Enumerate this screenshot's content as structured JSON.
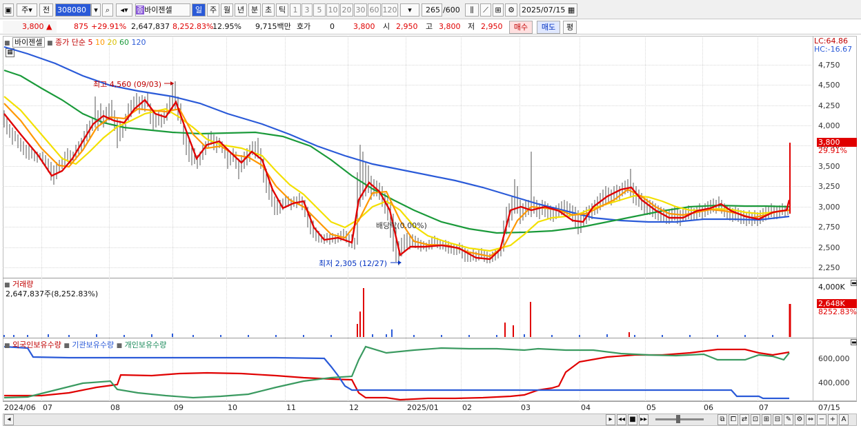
{
  "toolbar": {
    "type_label": "주",
    "prev_label": "전",
    "code": "308080",
    "stock_badge": "종",
    "stock_name": "바이젠셀",
    "periods": [
      "일",
      "주",
      "월",
      "년",
      "분",
      "초",
      "틱"
    ],
    "intervals": [
      "1",
      "3",
      "5",
      "10",
      "20",
      "30",
      "60",
      "120"
    ],
    "count": "265",
    "count_max": "/600",
    "date": "2025/07/15"
  },
  "quote": {
    "price": "3,800",
    "change": "875",
    "change_pct": "+29.91%",
    "volume": "2,647,837",
    "volume_pct": "8,252.83%",
    "turnover": "12.95%",
    "amount": "9,715백만",
    "hoga_label": "호가",
    "hoga": "0",
    "ask": "3,800",
    "open_label": "시",
    "open": "2,950",
    "high_label": "고",
    "high": "3,800",
    "low_label": "저",
    "low": "2,950",
    "buy": "매수",
    "sell": "매도",
    "eval": "평"
  },
  "legend": {
    "name": "바이젠셀",
    "ma_label": "종가 단순",
    "ma": [
      {
        "n": "5",
        "color": "#e00000"
      },
      {
        "n": "10",
        "color": "#ff9800"
      },
      {
        "n": "20",
        "color": "#e8d000"
      },
      {
        "n": "60",
        "color": "#1a9a3a"
      },
      {
        "n": "120",
        "color": "#2a5ad8"
      }
    ]
  },
  "lc": "LC:64.86",
  "hc": "HC:-16.67",
  "price_axis": [
    "4,750",
    "4,500",
    "4,250",
    "4,000",
    "3,750",
    "3,500",
    "3,250",
    "3,000",
    "2,750",
    "2,500",
    "2,250"
  ],
  "annot": {
    "high": "최고 4,560 (09/03)",
    "low": "최저 2,305 (12/27)",
    "div": "배당락(0.00%)"
  },
  "tag_price": "3,800",
  "tag_pct": "29.91%",
  "vol": {
    "title": "거래량",
    "value": "2,647,837주(8,252.83%)",
    "axis": "4,000K",
    "tag": "2,648K",
    "tag_pct": "8252.83%"
  },
  "hold": {
    "foreign": "외국인보유수량",
    "inst": "기관보유수량",
    "indiv": "개인보유수량",
    "axis": [
      "600,000",
      "400,000"
    ]
  },
  "xaxis": [
    "2024/06",
    "07",
    "08",
    "09",
    "10",
    "11",
    "12",
    "2025/01",
    "02",
    "03",
    "04",
    "05",
    "06",
    "07",
    "07/15"
  ],
  "chart_data": {
    "type": "candlestick",
    "series": [
      {
        "name": "5",
        "values": []
      }
    ]
  }
}
